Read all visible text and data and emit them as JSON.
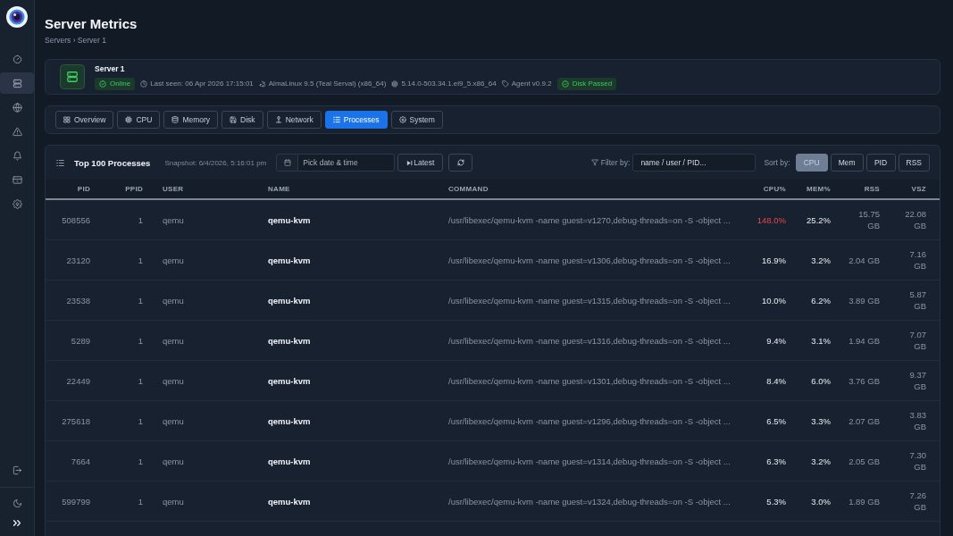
{
  "sidebar": {
    "items": [
      {
        "selected": false
      },
      {
        "selected": true
      },
      {
        "selected": false
      },
      {
        "selected": false
      },
      {
        "selected": false
      },
      {
        "selected": false
      },
      {
        "selected": false
      }
    ]
  },
  "header": {
    "title": "Server Metrics",
    "breadcrumb": "Servers › Server 1"
  },
  "server": {
    "name": "Server 1",
    "info": [
      {
        "kind": "badge",
        "text": "Online"
      },
      {
        "kind": "meta",
        "text": "Last seen: 06 Apr 2026 17:15:01"
      },
      {
        "kind": "meta",
        "text": "AlmaLinux 9.5 (Teal Serval) (x86_64)"
      },
      {
        "kind": "meta",
        "text": "5.14.0-503.34.1.el9_5.x86_64"
      },
      {
        "kind": "meta",
        "text": "Agent v0.9.2"
      },
      {
        "kind": "badge",
        "text": "Disk Passed"
      }
    ]
  },
  "tabs": [
    {
      "label": "Overview",
      "selected": false
    },
    {
      "label": "CPU",
      "selected": false
    },
    {
      "label": "Memory",
      "selected": false
    },
    {
      "label": "Disk",
      "selected": false
    },
    {
      "label": "Network",
      "selected": false
    },
    {
      "label": "Processes",
      "selected": true
    },
    {
      "label": "System",
      "selected": false
    }
  ],
  "processes": {
    "title": "Top 100 Processes",
    "snapshot": "Snapshot: 6/4/2026, 5:16:01 pm",
    "date_picker": {
      "placeholder": "Pick date & time"
    },
    "latest_button": "Latest",
    "filter": {
      "label": "Filter by:",
      "placeholder": "name / user / PID..."
    },
    "sort": {
      "label": "Sort by:",
      "options": [
        {
          "label": "CPU",
          "selected": true
        },
        {
          "label": "Mem",
          "selected": false
        },
        {
          "label": "PID",
          "selected": false
        },
        {
          "label": "RSS",
          "selected": false
        }
      ]
    },
    "table": {
      "columns": [
        "PID",
        "PPID",
        "USER",
        "NAME",
        "COMMAND",
        "CPU%",
        "MEM%",
        "RSS",
        "VSZ"
      ],
      "rows": [
        {
          "pid": "508556",
          "ppid": "1",
          "user": "qemu",
          "name": "qemu-kvm",
          "command": "/usr/libexec/qemu-kvm -name guest=v1270,debug-threads=on -S -object ...",
          "cpu": "148.0%",
          "cpu_high": true,
          "mem": "25.2%",
          "rss": "15.75 GB",
          "vsz": "22.08 GB"
        },
        {
          "pid": "23120",
          "ppid": "1",
          "user": "qemu",
          "name": "qemu-kvm",
          "command": "/usr/libexec/qemu-kvm -name guest=v1306,debug-threads=on -S -object ...",
          "cpu": "16.9%",
          "cpu_high": false,
          "mem": "3.2%",
          "rss": "2.04 GB",
          "vsz": "7.16 GB"
        },
        {
          "pid": "23538",
          "ppid": "1",
          "user": "qemu",
          "name": "qemu-kvm",
          "command": "/usr/libexec/qemu-kvm -name guest=v1315,debug-threads=on -S -object ...",
          "cpu": "10.0%",
          "cpu_high": false,
          "mem": "6.2%",
          "rss": "3.89 GB",
          "vsz": "5.87 GB"
        },
        {
          "pid": "5289",
          "ppid": "1",
          "user": "qemu",
          "name": "qemu-kvm",
          "command": "/usr/libexec/qemu-kvm -name guest=v1316,debug-threads=on -S -object ...",
          "cpu": "9.4%",
          "cpu_high": false,
          "mem": "3.1%",
          "rss": "1.94 GB",
          "vsz": "7.07 GB"
        },
        {
          "pid": "22449",
          "ppid": "1",
          "user": "qemu",
          "name": "qemu-kvm",
          "command": "/usr/libexec/qemu-kvm -name guest=v1301,debug-threads=on -S -object ...",
          "cpu": "8.4%",
          "cpu_high": false,
          "mem": "6.0%",
          "rss": "3.76 GB",
          "vsz": "9.37 GB"
        },
        {
          "pid": "275618",
          "ppid": "1",
          "user": "qemu",
          "name": "qemu-kvm",
          "command": "/usr/libexec/qemu-kvm -name guest=v1296,debug-threads=on -S -object ...",
          "cpu": "6.5%",
          "cpu_high": false,
          "mem": "3.3%",
          "rss": "2.07 GB",
          "vsz": "3.83 GB"
        },
        {
          "pid": "7664",
          "ppid": "1",
          "user": "qemu",
          "name": "qemu-kvm",
          "command": "/usr/libexec/qemu-kvm -name guest=v1314,debug-threads=on -S -object ...",
          "cpu": "6.3%",
          "cpu_high": false,
          "mem": "3.2%",
          "rss": "2.05 GB",
          "vsz": "7.30 GB"
        },
        {
          "pid": "599799",
          "ppid": "1",
          "user": "qemu",
          "name": "qemu-kvm",
          "command": "/usr/libexec/qemu-kvm -name guest=v1324,debug-threads=on -S -object ...",
          "cpu": "5.3%",
          "cpu_high": false,
          "mem": "3.0%",
          "rss": "1.89 GB",
          "vsz": "7.26 GB"
        }
      ]
    }
  }
}
